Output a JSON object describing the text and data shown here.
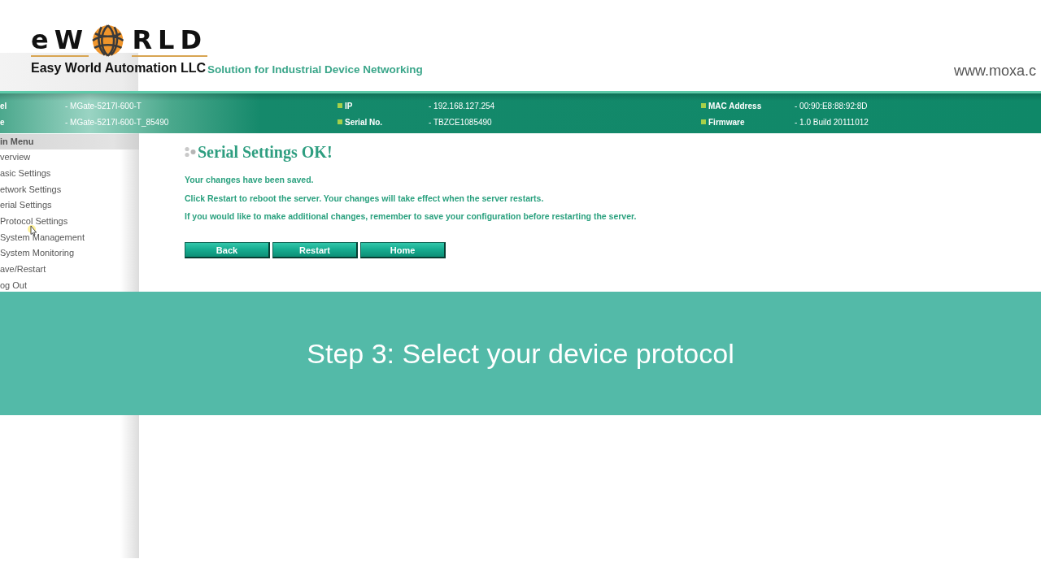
{
  "logo": {
    "wordmark": [
      "eW",
      "RLD"
    ],
    "company": "Easy World Automation LLC"
  },
  "header": {
    "tagline": "Solution for Industrial Device Networking",
    "website": "www.moxa.c"
  },
  "info_bar": {
    "fields": [
      {
        "label": "el",
        "value": "- MGate-5217I-600-T",
        "bullet": false
      },
      {
        "label": "IP",
        "value": "- 192.168.127.254",
        "bullet": true
      },
      {
        "label": "MAC Address",
        "value": "- 00:90:E8:88:92:8D",
        "bullet": true
      },
      {
        "label": "e",
        "value": "- MGate-5217I-600-T_85490",
        "bullet": false
      },
      {
        "label": "Serial No.",
        "value": "- TBZCE1085490",
        "bullet": true
      },
      {
        "label": "Firmware",
        "value": "- 1.0 Build 20111012",
        "bullet": true
      }
    ]
  },
  "sidebar": {
    "title": "in Menu",
    "items": [
      "verview",
      "asic Settings",
      "etwork Settings",
      "erial Settings",
      "Protocol Settings",
      "System Management",
      "System Monitoring",
      "ave/Restart",
      "og Out"
    ]
  },
  "content": {
    "title": "Serial Settings OK!",
    "paragraphs": [
      "Your changes have been saved.",
      "Click Restart to reboot the server. Your changes will take effect when the server restarts.",
      "If you would like to make additional changes, remember to save your configuration before restarting the server."
    ],
    "buttons": [
      "Back",
      "Restart",
      "Home"
    ]
  },
  "caption": {
    "text": "Step 3: Select your device protocol"
  }
}
